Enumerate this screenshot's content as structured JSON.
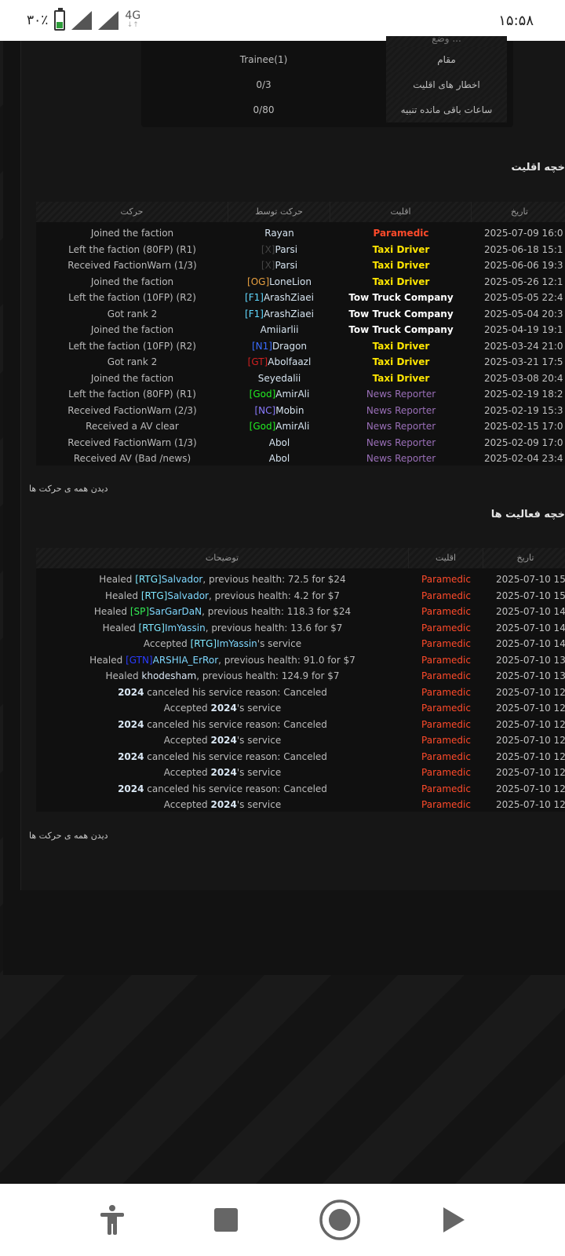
{
  "status_bar": {
    "battery": "۳۰٪",
    "network": "4G",
    "time": "۱۵:۵۸"
  },
  "info": {
    "rows": [
      {
        "key": "مقام",
        "value": "Trainee(1)"
      },
      {
        "key": "اخطار های اقلیت",
        "value": "0/3"
      },
      {
        "key": "ساعات باقی مانده تنبیه",
        "value": "0/80"
      }
    ],
    "partial_key": "وضع ..."
  },
  "faction_history": {
    "title": "خچه اقلیت",
    "headers": {
      "action": "حرکت",
      "by": "حرکت توسط",
      "faction": "اقلیت",
      "date": "تاریخ"
    },
    "rows": [
      {
        "action": "Joined the faction",
        "tag": "",
        "name": "Rayan",
        "faction": "Paramedic",
        "date": "2025-07-09 16:0"
      },
      {
        "action": "Left the faction (80FP) (R1)",
        "tag": "[X]",
        "name": "Parsi",
        "faction": "Taxi Driver",
        "date": "2025-06-18 15:1"
      },
      {
        "action": "Received FactionWarn (1/3)",
        "tag": "[X]",
        "name": "Parsi",
        "faction": "Taxi Driver",
        "date": "2025-06-06 19:3"
      },
      {
        "action": "Joined the faction",
        "tag": "[OG]",
        "name": "LoneLion",
        "faction": "Taxi Driver",
        "date": "2025-05-26 12:1"
      },
      {
        "action": "Left the faction (10FP) (R2)",
        "tag": "[F1]",
        "name": "ArashZiaei",
        "faction": "Tow Truck Company",
        "date": "2025-05-05 22:4"
      },
      {
        "action": "Got rank 2",
        "tag": "[F1]",
        "name": "ArashZiaei",
        "faction": "Tow Truck Company",
        "date": "2025-05-04 20:3"
      },
      {
        "action": "Joined the faction",
        "tag": "",
        "name": "Amiiarlii",
        "faction": "Tow Truck Company",
        "date": "2025-04-19 19:1"
      },
      {
        "action": "Left the faction (10FP) (R2)",
        "tag": "[N1]",
        "name": "Dragon",
        "faction": "Taxi Driver",
        "date": "2025-03-24 21:0"
      },
      {
        "action": "Got rank 2",
        "tag": "[GT]",
        "name": "Abolfaazl",
        "faction": "Taxi Driver",
        "date": "2025-03-21 17:5"
      },
      {
        "action": "Joined the faction",
        "tag": "",
        "name": "Seyedalii",
        "faction": "Taxi Driver",
        "date": "2025-03-08 20:4"
      },
      {
        "action": "Left the faction (80FP) (R1)",
        "tag": "[God]",
        "name": "AmirAli",
        "faction": "News Reporter",
        "date": "2025-02-19 18:2"
      },
      {
        "action": "Received FactionWarn (2/3)",
        "tag": "[NC]",
        "name": "Mobin",
        "faction": "News Reporter",
        "date": "2025-02-19 15:3"
      },
      {
        "action": "Received a AV clear",
        "tag": "[God]",
        "name": "AmirAli",
        "faction": "News Reporter",
        "date": "2025-02-15 17:0"
      },
      {
        "action": "Received FactionWarn (1/3)",
        "tag": "",
        "name": "Abol",
        "faction": "News Reporter",
        "date": "2025-02-09 17:0"
      },
      {
        "action": "Received AV (Bad /news)",
        "tag": "",
        "name": "Abol",
        "faction": "News Reporter",
        "date": "2025-02-04 23:4"
      }
    ],
    "view_all": "دیدن همه ی حرکت ها"
  },
  "activity_history": {
    "title": "خچه فعالیت ها",
    "headers": {
      "desc": "توضیحات",
      "faction": "اقلیت",
      "date": "تاریخ"
    },
    "rows": [
      {
        "pre": "Healed ",
        "hl": "[RTG]",
        "name": "Salvador",
        "post": ", previous health: 72.5 for $24",
        "faction": "Paramedic",
        "date": "2025-07-10 15:"
      },
      {
        "pre": "Healed ",
        "hl": "[RTG]",
        "name": "Salvador",
        "post": ", previous health: 4.2 for $7",
        "faction": "Paramedic",
        "date": "2025-07-10 15:"
      },
      {
        "pre": "Healed ",
        "hl": "[SP]",
        "name": "SarGarDaN",
        "post": ", previous health: 118.3 for $24",
        "faction": "Paramedic",
        "date": "2025-07-10 14:"
      },
      {
        "pre": "Healed ",
        "hl": "[RTG]",
        "name": "ImYassin",
        "post": ", previous health: 13.6 for $7",
        "faction": "Paramedic",
        "date": "2025-07-10 14:"
      },
      {
        "pre": "Accepted ",
        "hl": "[RTG]",
        "name": "ImYassin",
        "post": "'s service",
        "faction": "Paramedic",
        "date": "2025-07-10 14:"
      },
      {
        "pre": "Healed ",
        "hl": "[GTN]",
        "name": "ARSHIA_ErRor",
        "post": ", previous health: 91.0 for $7",
        "faction": "Paramedic",
        "date": "2025-07-10 13:"
      },
      {
        "pre": "Healed ",
        "hl": "",
        "name": "khodesham",
        "post": ", previous health: 124.9 for $7",
        "faction": "Paramedic",
        "date": "2025-07-10 13:"
      },
      {
        "pre": "",
        "hl": "",
        "name": "2024",
        "post": " canceled his service reason: Canceled",
        "faction": "Paramedic",
        "date": "2025-07-10 12:"
      },
      {
        "pre": "Accepted ",
        "hl": "",
        "name": "2024",
        "post": "'s service",
        "faction": "Paramedic",
        "date": "2025-07-10 12:"
      },
      {
        "pre": "",
        "hl": "",
        "name": "2024",
        "post": " canceled his service reason: Canceled",
        "faction": "Paramedic",
        "date": "2025-07-10 12:"
      },
      {
        "pre": "Accepted ",
        "hl": "",
        "name": "2024",
        "post": "'s service",
        "faction": "Paramedic",
        "date": "2025-07-10 12:"
      },
      {
        "pre": "",
        "hl": "",
        "name": "2024",
        "post": " canceled his service reason: Canceled",
        "faction": "Paramedic",
        "date": "2025-07-10 12:"
      },
      {
        "pre": "Accepted ",
        "hl": "",
        "name": "2024",
        "post": "'s service",
        "faction": "Paramedic",
        "date": "2025-07-10 12:"
      },
      {
        "pre": "",
        "hl": "",
        "name": "2024",
        "post": " canceled his service reason: Canceled",
        "faction": "Paramedic",
        "date": "2025-07-10 12:"
      },
      {
        "pre": "Accepted ",
        "hl": "",
        "name": "2024",
        "post": "'s service",
        "faction": "Paramedic",
        "date": "2025-07-10 12:"
      }
    ],
    "view_all": "دیدن همه ی حرکت ها"
  },
  "colors": {
    "Paramedic": "#ff4a2a",
    "Taxi Driver": "#ffe600",
    "Tow Truck Company": "#ffffff",
    "News Reporter": "#9a6fb8",
    "tags": {
      "[X]": "#444444",
      "[OG]": "#e8a040",
      "[F1]": "#60d8ff",
      "[N1]": "#3a6cff",
      "[GT]": "#d02020",
      "[God]": "#22ee22",
      "[NC]": "#8a7aff"
    },
    "hl_tags": {
      "[RTG]": "#7fe8ff",
      "[SP]": "#33ee55",
      "[GTN]": "#2a3cff"
    }
  }
}
